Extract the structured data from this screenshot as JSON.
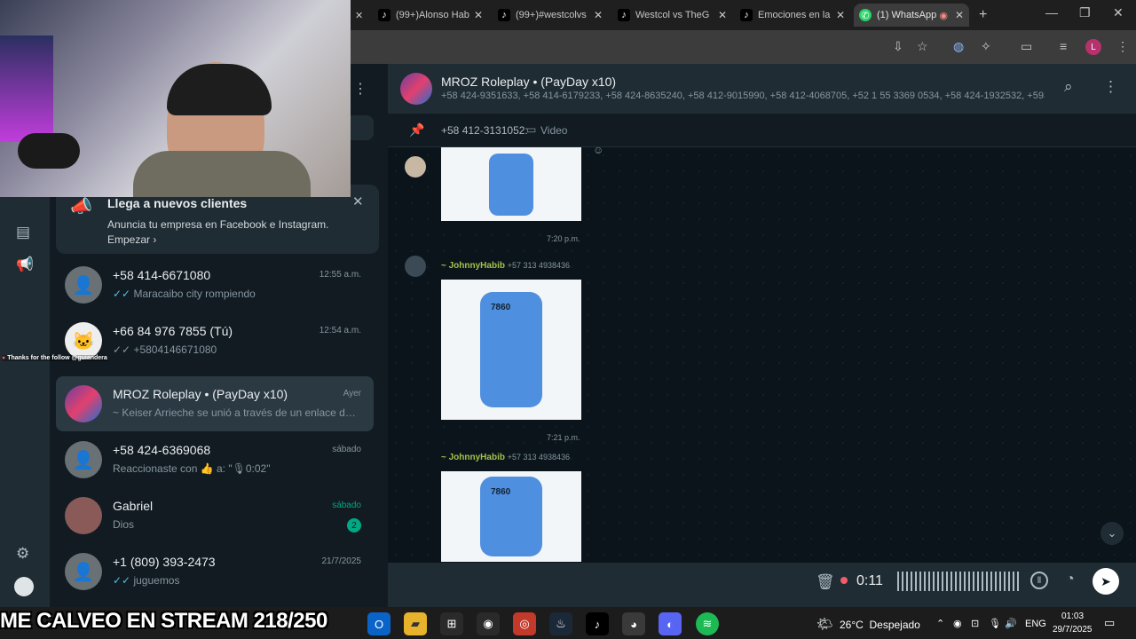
{
  "browser": {
    "tabs": [
      {
        "label": "(99+)Alonso Hab",
        "icon": "tiktok-icon"
      },
      {
        "label": "(99+)#westcolvs",
        "icon": "tiktok-icon"
      },
      {
        "label": "Westcol vs TheG",
        "icon": "tiktok-icon"
      },
      {
        "label": "Emociones en la",
        "icon": "tiktok-icon"
      },
      {
        "label": "(1) WhatsApp",
        "icon": "whatsapp-icon"
      }
    ],
    "profile_initial": "L"
  },
  "promo": {
    "title": "Llega a nuevos clientes",
    "body": "Anuncia tu empresa en Facebook e Instagram.",
    "link": "Empezar"
  },
  "chats": [
    {
      "name": "+58 414-6671080",
      "preview": "Maracaibo city rompiendo",
      "time": "12:55 a.m."
    },
    {
      "name": "+66 84 976 7855 (Tú)",
      "preview": "+5804146671080",
      "time": "12:54 a.m."
    },
    {
      "name": "MROZ Roleplay • (PayDay x10)",
      "preview": "~ Keiser Arrieche se unió a través de un enlace de in...",
      "time": "Ayer"
    },
    {
      "name": "+58 424-6369068",
      "preview": "Reaccionaste con 👍 a: \"🎙0:02\"",
      "time": "sábado"
    },
    {
      "name": "Gabriel",
      "preview": "Dios",
      "time": "sábado",
      "unread": "2"
    },
    {
      "name": "+1 (809) 393-2473",
      "preview": "juguemos",
      "time": "21/7/2025"
    }
  ],
  "stream_alert": "Thanks for the follow @guiandera",
  "conversation": {
    "title": "MROZ Roleplay • (PayDay x10)",
    "members": "+58 424-9351633, +58 414-6179233, +58 424-8635240, +58 412-9015990, +58 412-4068705, +52 1 55 3369 0534, +58 424-1932532, +593 ...",
    "pinned_sender": "+58 412-3131052:",
    "pinned_type": "Video",
    "messages": [
      {
        "sender": "",
        "phone": "",
        "time": "7:20 p.m."
      },
      {
        "sender": "~ JohnnyHabib",
        "phone": "+57 313 4938436",
        "time": "7:21 p.m."
      },
      {
        "sender": "~ JohnnyHabib",
        "phone": "+57 313 4938436",
        "time": ""
      }
    ],
    "sticker_text": "7860"
  },
  "recorder": {
    "duration": "0:11"
  },
  "overlay_text": "ME CALVEO EN STREAM 218/250",
  "taskbar": {
    "weather": "26°C  Despejado",
    "lang": "ENG",
    "time": "01:03",
    "date": "29/7/2025"
  },
  "colors": {
    "accent": "#00a884",
    "sender": "#a5c14a",
    "bg": "#0b141a"
  }
}
